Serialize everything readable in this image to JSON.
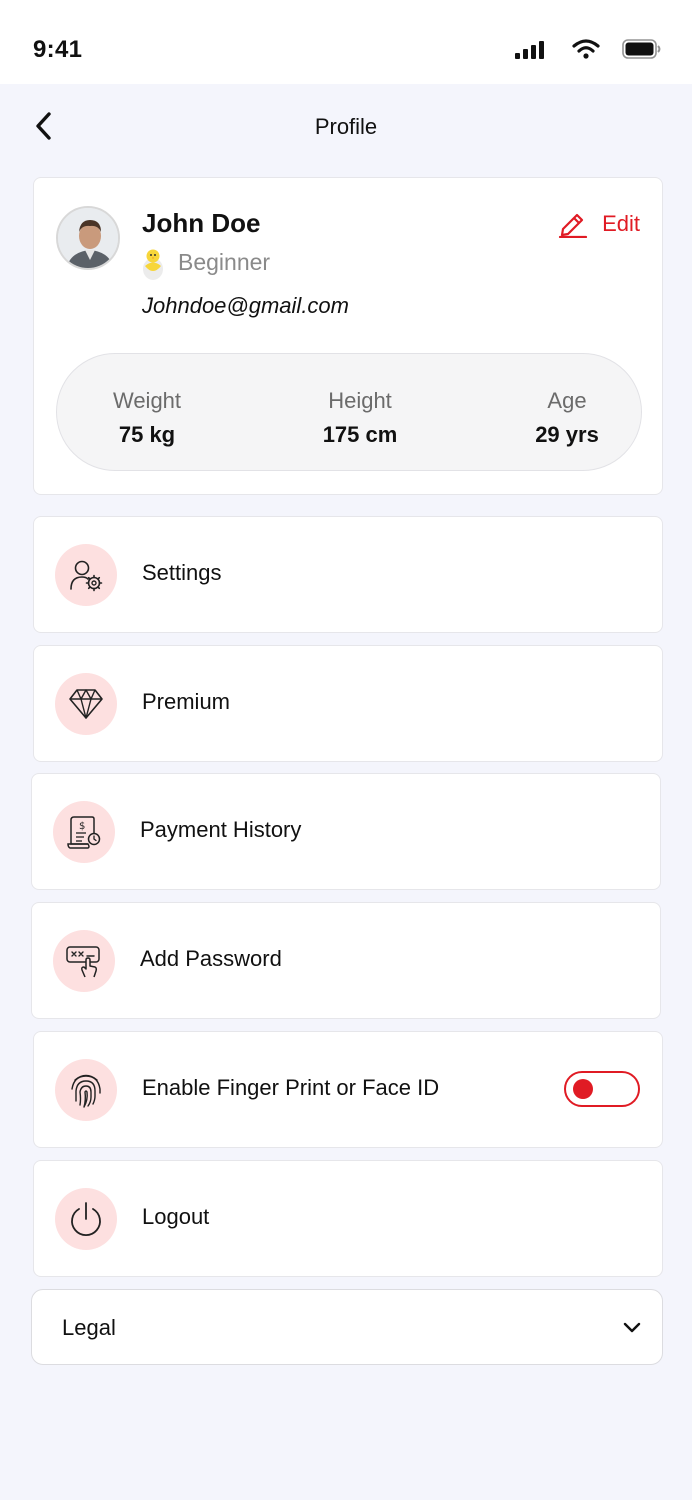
{
  "status_bar": {
    "time": "9:41"
  },
  "header": {
    "title": "Profile"
  },
  "profile": {
    "name": "John Doe",
    "level": "Beginner",
    "email": "Johndoe@gmail.com",
    "edit_label": "Edit",
    "stats": {
      "weight": {
        "label": "Weight",
        "value": "75 kg"
      },
      "height": {
        "label": "Height",
        "value": "175 cm"
      },
      "age": {
        "label": "Age",
        "value": "29 yrs"
      }
    }
  },
  "menu": {
    "settings": {
      "label": "Settings",
      "icon": "user-settings-icon"
    },
    "premium": {
      "label": "Premium",
      "icon": "diamond-icon"
    },
    "payment_history": {
      "label": "Payment History",
      "icon": "receipt-icon"
    },
    "add_password": {
      "label": "Add Password",
      "icon": "password-icon"
    },
    "biometric": {
      "label": "Enable Finger Print or Face ID",
      "icon": "fingerprint-icon",
      "enabled": false
    },
    "logout": {
      "label": "Logout",
      "icon": "power-icon"
    }
  },
  "legal": {
    "label": "Legal"
  },
  "colors": {
    "accent": "#e01b24",
    "icon_bg": "#fde0e0",
    "background": "#f4f5fc"
  }
}
